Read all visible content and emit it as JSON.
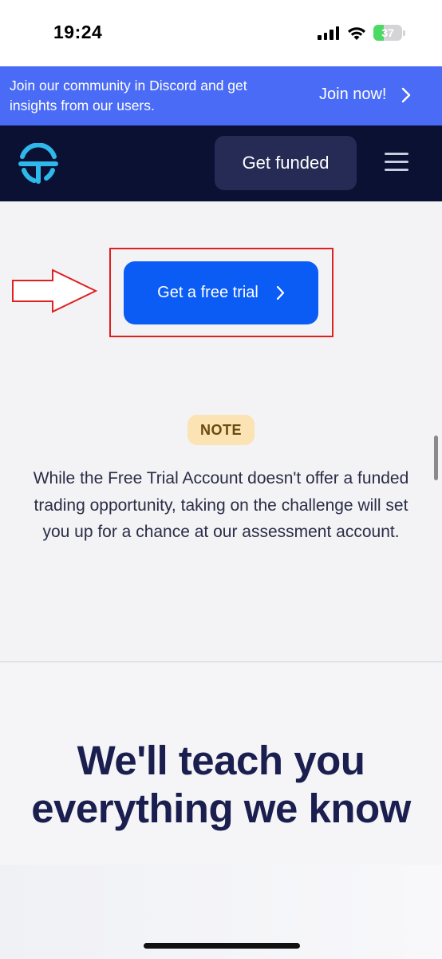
{
  "status_bar": {
    "time": "19:24",
    "battery": "37",
    "battery_level": 0.37,
    "icons": [
      "signal-icon",
      "wifi-icon",
      "battery-icon"
    ]
  },
  "banner": {
    "text": "Join our community in Discord and get insights from our users.",
    "cta": "Join now!",
    "cta_icon": "chevron-right-icon",
    "color": "#4a6bf5"
  },
  "header": {
    "logo_icon": "brand-logo-icon",
    "get_funded": "Get funded",
    "menu_icon": "hamburger-menu-icon",
    "color": "#0b1133"
  },
  "trial": {
    "button_label": "Get a free trial",
    "button_icon": "chevron-right-icon",
    "button_color": "#0a5cf5",
    "annotation_color": "#e02020"
  },
  "note": {
    "badge": "NOTE",
    "text": "While the Free Trial Account doesn't offer a funded trading opportunity, taking on the challenge will set you up for a chance at our assessment account."
  },
  "section": {
    "heading": "We'll teach you everything we know"
  }
}
